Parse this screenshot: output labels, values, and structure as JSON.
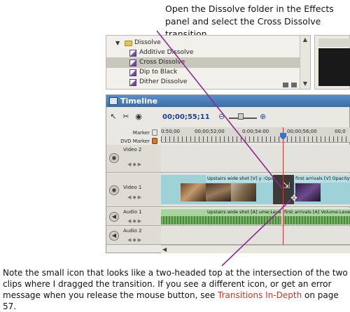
{
  "captions": {
    "top": "Open the Dissolve folder in the Effects panel and select the Cross Dissolve transition.",
    "bottom_pre": "Note the small icon that looks like a two-headed top at the intersection of the two clips where I dragged the transition. If you see a different icon, or get an error message when you release the mouse button, see ",
    "bottom_link": "Transitions In-Depth",
    "bottom_post": " on page 57."
  },
  "effects_panel": {
    "folder": "Dissolve",
    "items": [
      "Additive Dissolve",
      "Cross Dissolve",
      "Dip to Black",
      "Dither Dissolve"
    ],
    "selected": "Cross Dissolve",
    "colors": {
      "selected_row": "#c9c6bb",
      "folder": "#e5c556",
      "transition_icon": "#5b3c85"
    }
  },
  "timeline": {
    "title": "Timeline",
    "timecode": "00;00;55;11",
    "ruler_labels": [
      "0:50;00",
      "00;00;52;00",
      "0:00;54:00",
      "00;00;56;00",
      "00;0"
    ],
    "marker_label": "Marker",
    "dvd_marker_label": "DVD Marker",
    "tracks": {
      "video2": "Video 2",
      "video1": "Video 1",
      "audio1": "Audio 1",
      "audio2": "Audio 2"
    },
    "video_clips": {
      "clip1": "Upstairs wide shot [V]  y :Opa",
      "clip2": "first arrivals [V]  Opacity:Opacity"
    },
    "audio_clips": {
      "clip1": "Upstairs wide shot [A]  ume:Level",
      "clip2": "first arrivals [A]  Volume:Level"
    },
    "colors": {
      "title_bar": "#3a6ea8",
      "video_clip": "#9ed2d8",
      "audio_clip": "#a8d4a0",
      "playhead": "#d03a3a",
      "callout_line": "#8e2a8e"
    }
  }
}
